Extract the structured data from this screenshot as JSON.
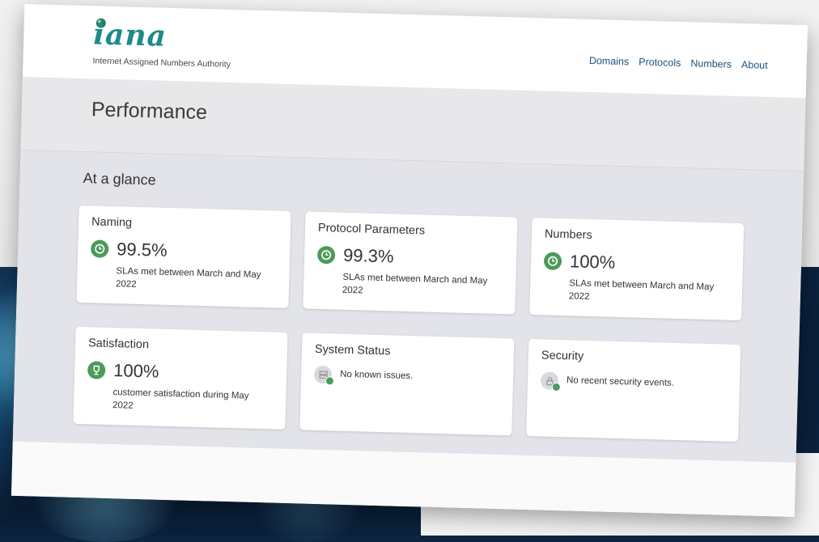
{
  "header": {
    "logo_text": "iana",
    "tagline": "Internet Assigned Numbers Authority",
    "nav": [
      "Domains",
      "Protocols",
      "Numbers",
      "About"
    ]
  },
  "page_title": "Performance",
  "section_title": "At a glance",
  "cards": [
    {
      "title": "Naming",
      "value": "99.5%",
      "desc": "SLAs met between March and May 2022",
      "icon": "clock-icon"
    },
    {
      "title": "Protocol Parameters",
      "value": "99.3%",
      "desc": "SLAs met between March and May 2022",
      "icon": "clock-icon"
    },
    {
      "title": "Numbers",
      "value": "100%",
      "desc": "SLAs met between March and May 2022",
      "icon": "clock-icon"
    },
    {
      "title": "Satisfaction",
      "value": "100%",
      "desc": "customer satisfaction during May 2022",
      "icon": "trophy-icon"
    },
    {
      "title": "System Status",
      "text": "No known issues.",
      "icon": "server-icon"
    },
    {
      "title": "Security",
      "text": "No recent security events.",
      "icon": "lock-icon"
    }
  ],
  "colors": {
    "brand_teal": "#1f8a89",
    "nav_link": "#1d4f7a",
    "status_green": "#4d9a5b",
    "content_bg": "#e3e4ea"
  }
}
